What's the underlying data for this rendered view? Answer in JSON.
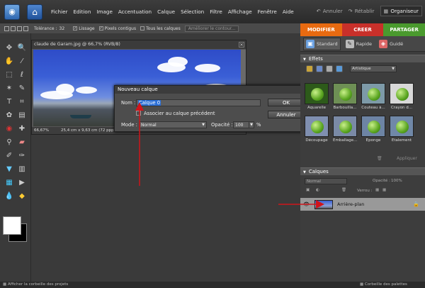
{
  "menubar": {
    "items": [
      "Fichier",
      "Edition",
      "Image",
      "Accentuation",
      "Calque",
      "Sélection",
      "Filtre",
      "Affichage",
      "Fenêtre",
      "Aide"
    ],
    "undo_label": "Annuler",
    "redo_label": "Rétablir",
    "organiser_label": "Organiseur"
  },
  "options": {
    "tolerance_label": "Tolérance :",
    "tolerance_value": "32",
    "lissage_label": "Lissage",
    "pixels_label": "Pixels contigus",
    "tous_calques_label": "Tous les calques",
    "ameliorer_label": "Améliorer le contour..."
  },
  "mode_tabs": {
    "modifier": "MODIFIER",
    "creer": "CREER",
    "partager": "PARTAGER"
  },
  "mode_buttons": {
    "standard": "Standard",
    "rapide": "Rapide",
    "guide": "Guidé"
  },
  "document": {
    "title": "claude de Garam.jpg @ 66,7% (RVB/8)",
    "zoom": "66,67%",
    "size": "25,4 cm x 9,63 cm (72 ppp)"
  },
  "dialog": {
    "title": "Nouveau calque",
    "name_label": "Nom :",
    "name_value": "Calque 0",
    "associate_label": "Associer au calque précédent",
    "mode_label": "Mode :",
    "mode_value": "Normal",
    "opacity_label": "Opacité :",
    "opacity_value": "100",
    "opacity_unit": "%",
    "ok_label": "OK",
    "cancel_label": "Annuler"
  },
  "effects": {
    "header": "Effets",
    "category": "Artistique",
    "apply_label": "Appliquer",
    "items": [
      {
        "name": "Aquarelle",
        "bg": "#2d5a1a"
      },
      {
        "name": "Barbouilla...",
        "bg": "#6e8f55"
      },
      {
        "name": "Couteau à...",
        "bg": "#7d9aa8"
      },
      {
        "name": "Crayon d...",
        "bg": "#d8d8d8"
      },
      {
        "name": "Découpage",
        "bg": "#7f8fb0"
      },
      {
        "name": "Emballage...",
        "bg": "#7a8aa6"
      },
      {
        "name": "Eponge",
        "bg": "#6d84a4"
      },
      {
        "name": "Etalement",
        "bg": "#7088a8"
      }
    ]
  },
  "layers": {
    "header": "Calques",
    "blend_mode": "Normal",
    "opacity_label": "Opacité :",
    "opacity_value": "100%",
    "lock_label": "Verrou :",
    "layer_name": "Arrière-plan"
  },
  "bottombar": {
    "left_label": "Afficher la corbeille des projets",
    "right_label": "Corbeille des palettes"
  },
  "colors": {
    "modifier": "#e86a10",
    "creer": "#c8302a",
    "partager": "#4a9a2e",
    "annotation_arrow": "#d0141a"
  }
}
